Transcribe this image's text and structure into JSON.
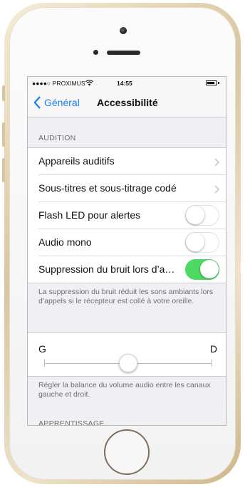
{
  "status_bar": {
    "carrier": "●●●●○ PROXIMUS",
    "time": "14:55"
  },
  "nav": {
    "back_label": "Général",
    "title": "Accessibilité"
  },
  "sections": {
    "audition_header": "AUDITION",
    "rows": [
      {
        "label": "Appareils auditifs",
        "type": "disclosure"
      },
      {
        "label": "Sous-titres et sous-titrage codé",
        "type": "disclosure"
      },
      {
        "label": "Flash LED pour alertes",
        "type": "switch",
        "on": false
      },
      {
        "label": "Audio mono",
        "type": "switch",
        "on": false
      },
      {
        "label": "Suppression du bruit lors d’a…",
        "type": "switch",
        "on": true
      }
    ],
    "noise_footnote": "La suppression du bruit réduit les sons ambiants lors d’appels si le récepteur est collé à votre oreille.",
    "balance": {
      "left_label": "G",
      "right_label": "D",
      "value": 0.5
    },
    "balance_footnote": "Régler la balance du volume audio entre les canaux gauche et droit.",
    "next_header": "APPRENTISSAGE"
  },
  "colors": {
    "accent": "#1a7df6",
    "switch_on": "#4cd964",
    "grouped_bg": "#efeff4"
  }
}
